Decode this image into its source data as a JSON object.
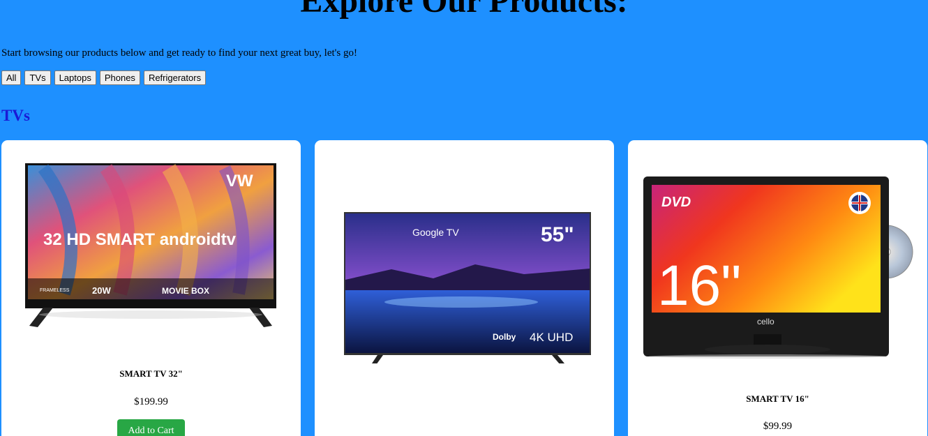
{
  "header": {
    "title": "Explore Our Products:",
    "intro": "Start browsing our products below and get ready to find your next great buy, let's go!"
  },
  "filters": [
    {
      "label": "All"
    },
    {
      "label": "TVs"
    },
    {
      "label": "Laptops"
    },
    {
      "label": "Phones"
    },
    {
      "label": "Refrigerators"
    }
  ],
  "section": {
    "heading": "TVs"
  },
  "products": [
    {
      "name": "SMART TV 32\"",
      "price": "$199.99",
      "button_label": "Add to Cart",
      "image_labels": {
        "headline": "32 HD SMART androidtv",
        "brand": "VW",
        "features": [
          "FRAMELESS",
          "20W",
          "MOVIE BOX"
        ]
      }
    },
    {
      "name": "",
      "price": "",
      "image_labels": {
        "platform": "Google TV",
        "size": "55\"",
        "badges": [
          "Dolby",
          "4K UHD"
        ]
      }
    },
    {
      "name": "SMART TV 16\"",
      "price": "$99.99",
      "image_labels": {
        "size": "16\"",
        "badge": "DVD",
        "brand": "cello"
      }
    }
  ],
  "colors": {
    "page_background": "#1e90ff",
    "section_heading": "#1a1ad6",
    "cart_button": "#28a745",
    "card_background": "#ffffff"
  }
}
